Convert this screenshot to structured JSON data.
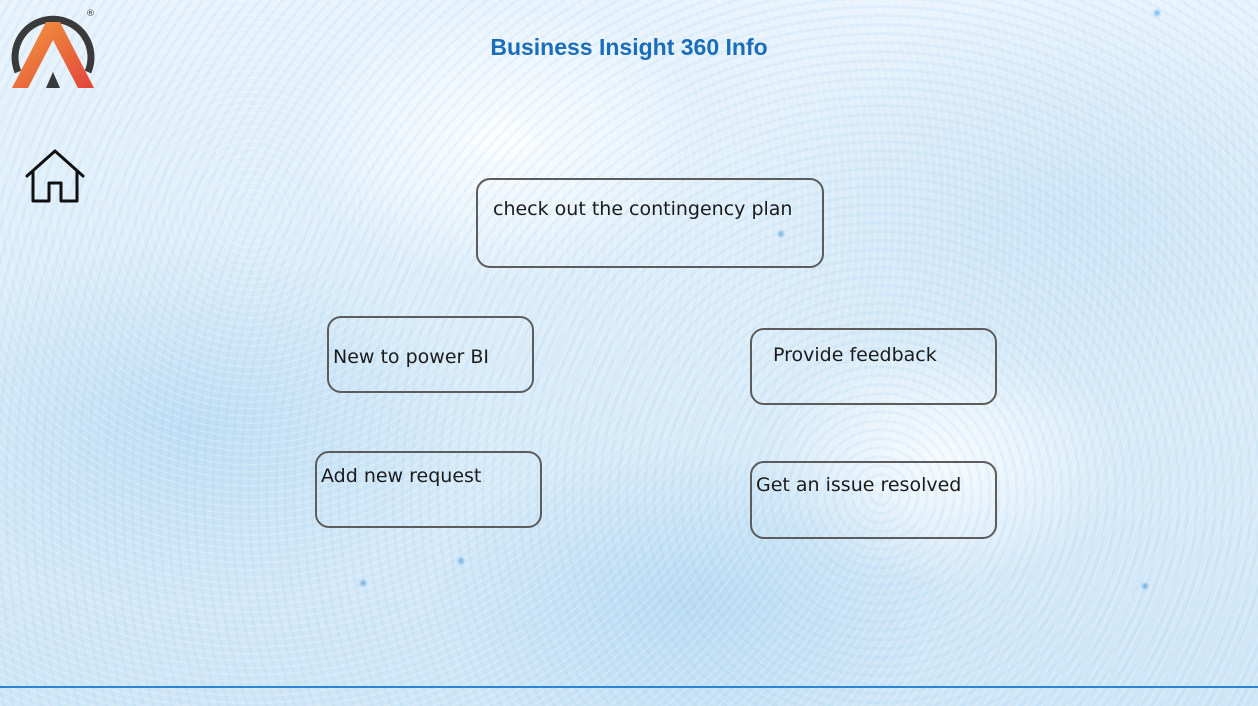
{
  "header": {
    "title": "Business Insight 360 Info",
    "logo_mark": "®"
  },
  "nav": {
    "home_icon": "home-icon"
  },
  "buttons": {
    "contingency": "check out the contingency plan",
    "new_to_power_bi": "New to power BI",
    "provide_feedback": "Provide feedback",
    "add_new_request": "Add new request",
    "get_issue_resolved": "Get an issue resolved"
  },
  "colors": {
    "title": "#1a6dbb",
    "button_border": "#5c5c5c",
    "logo_orange": "#f07a3a",
    "logo_red": "#e2453c",
    "logo_dark": "#3a3a3a",
    "footer_line": "#2a86d4"
  }
}
